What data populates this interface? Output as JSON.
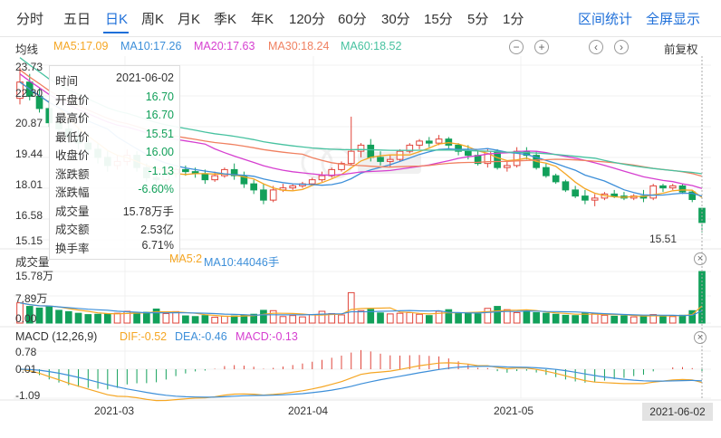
{
  "tabs": [
    {
      "name": "tab-fenshi",
      "label": "分时"
    },
    {
      "name": "tab-5day",
      "label": "五日"
    },
    {
      "name": "tab-daily-k",
      "label": "日K",
      "active": true
    },
    {
      "name": "tab-weekly-k",
      "label": "周K"
    },
    {
      "name": "tab-monthly-k",
      "label": "月K"
    },
    {
      "name": "tab-quarterly-k",
      "label": "季K"
    },
    {
      "name": "tab-yearly-k",
      "label": "年K"
    },
    {
      "name": "tab-120min",
      "label": "120分"
    },
    {
      "name": "tab-60min",
      "label": "60分"
    },
    {
      "name": "tab-30min",
      "label": "30分"
    },
    {
      "name": "tab-15min",
      "label": "15分"
    },
    {
      "name": "tab-5min",
      "label": "5分"
    },
    {
      "name": "tab-1min",
      "label": "1分"
    }
  ],
  "tools": {
    "range_stats": "区间统计",
    "fullscreen": "全屏显示"
  },
  "ma_legend": {
    "title": "均线",
    "ma5": "MA5:17.09",
    "ma10": "MA10:17.26",
    "ma20": "MA20:17.63",
    "ma30": "MA30:18.24",
    "ma60": "MA60:18.52",
    "ma5_color": "#f5a623",
    "ma10_color": "#3d8fd9",
    "ma20_color": "#d63fd0",
    "ma30_color": "#f08060",
    "ma60_color": "#47c2a0"
  },
  "zoom": {
    "out": "−",
    "in": "+",
    "left": "‹",
    "right": "›"
  },
  "adjust_label": "前复权",
  "price_axis": [
    "23.73",
    "22.30",
    "20.87",
    "19.44",
    "18.01",
    "16.58",
    "15.15"
  ],
  "last_price": "15.51",
  "tooltip": [
    {
      "k": "时间",
      "v": "2021-06-02",
      "c": "#333"
    },
    {
      "k": "开盘价",
      "v": "16.70",
      "c": "#12a05a"
    },
    {
      "k": "最高价",
      "v": "16.70",
      "c": "#12a05a"
    },
    {
      "k": "最低价",
      "v": "15.51",
      "c": "#12a05a"
    },
    {
      "k": "收盘价",
      "v": "16.00",
      "c": "#12a05a"
    },
    {
      "k": "涨跌额",
      "v": "-1.13",
      "c": "#12a05a"
    },
    {
      "k": "涨跌幅",
      "v": "-6.60%",
      "c": "#12a05a"
    },
    {
      "k": "成交量",
      "v": "15.78万手",
      "c": "#333"
    },
    {
      "k": "成交额",
      "v": "2.53亿",
      "c": "#333"
    },
    {
      "k": "换手率",
      "v": "6.71%",
      "c": "#333"
    }
  ],
  "volume": {
    "title": "成交量",
    "ma5": "MA5:2",
    "ma10": "MA10:44046手",
    "axis": [
      "15.78万",
      "7.89万",
      "0.00"
    ]
  },
  "macd": {
    "title": "MACD (12,26,9)",
    "dif": "DIF:-0.52",
    "dea": "DEA:-0.46",
    "macd": "MACD:-0.13",
    "axis": [
      "0.78",
      "0.01",
      "-1.09"
    ]
  },
  "x_axis": [
    "2021-03",
    "2021-04",
    "2021-05"
  ],
  "last_date": "2021-06-02",
  "chart_data": {
    "type": "candlestick",
    "up_color": "#e0443a",
    "down_color": "#12a05a",
    "bars": [
      [
        22.1,
        23.6,
        21.8,
        22.9,
        6.2
      ],
      [
        22.9,
        23.3,
        22.0,
        22.2,
        5.1
      ],
      [
        22.2,
        22.6,
        21.4,
        21.6,
        4.6
      ],
      [
        21.6,
        22.0,
        20.7,
        20.9,
        5.0
      ],
      [
        20.9,
        21.3,
        20.2,
        20.6,
        3.9
      ],
      [
        20.6,
        21.0,
        19.9,
        20.2,
        3.5
      ],
      [
        20.2,
        20.6,
        19.6,
        19.9,
        3.0
      ],
      [
        19.9,
        20.4,
        19.3,
        19.6,
        2.6
      ],
      [
        19.6,
        19.9,
        18.9,
        19.2,
        2.7
      ],
      [
        19.2,
        19.5,
        18.5,
        18.8,
        2.8
      ],
      [
        18.8,
        19.3,
        18.6,
        19.0,
        3.0
      ],
      [
        19.0,
        19.6,
        18.8,
        19.3,
        3.6
      ],
      [
        19.3,
        19.5,
        18.5,
        18.7,
        3.1
      ],
      [
        18.7,
        18.9,
        18.0,
        18.2,
        3.3
      ],
      [
        18.2,
        18.5,
        17.9,
        18.1,
        4.3
      ],
      [
        18.1,
        18.6,
        17.9,
        18.4,
        2.9
      ],
      [
        18.4,
        18.7,
        18.2,
        18.6,
        3.5
      ],
      [
        18.6,
        18.8,
        18.3,
        18.5,
        2.2
      ],
      [
        18.5,
        18.7,
        18.2,
        18.4,
        2.0
      ],
      [
        18.4,
        18.6,
        17.9,
        18.1,
        2.3
      ],
      [
        18.1,
        18.5,
        18.0,
        18.3,
        1.8
      ],
      [
        18.3,
        18.7,
        18.2,
        18.6,
        2.1
      ],
      [
        18.6,
        18.9,
        18.1,
        18.3,
        2.2
      ],
      [
        18.3,
        18.5,
        17.7,
        17.9,
        2.5
      ],
      [
        17.9,
        18.1,
        17.4,
        17.6,
        2.7
      ],
      [
        17.6,
        17.9,
        16.9,
        17.1,
        3.9
      ],
      [
        17.1,
        17.8,
        17.0,
        17.6,
        3.8
      ],
      [
        17.6,
        17.9,
        17.5,
        17.7,
        2.0
      ],
      [
        17.7,
        17.9,
        17.6,
        17.8,
        2.3
      ],
      [
        17.8,
        18.0,
        17.7,
        17.9,
        1.9
      ],
      [
        17.9,
        18.2,
        17.8,
        18.1,
        2.5
      ],
      [
        18.1,
        18.5,
        18.0,
        18.3,
        3.6
      ],
      [
        18.3,
        18.7,
        18.2,
        18.6,
        2.9
      ],
      [
        18.6,
        19.0,
        18.5,
        18.9,
        2.5
      ],
      [
        18.9,
        21.2,
        18.8,
        19.5,
        9.3
      ],
      [
        19.5,
        19.9,
        19.2,
        19.8,
        3.8
      ],
      [
        19.8,
        20.1,
        19.0,
        19.2,
        4.2
      ],
      [
        19.2,
        19.5,
        18.8,
        19.0,
        3.1
      ],
      [
        19.0,
        19.3,
        18.7,
        19.1,
        2.8
      ],
      [
        19.1,
        19.6,
        19.0,
        19.5,
        3.0
      ],
      [
        19.5,
        19.9,
        19.4,
        19.8,
        3.2
      ],
      [
        19.8,
        20.1,
        19.6,
        20.0,
        2.7
      ],
      [
        20.0,
        20.2,
        19.7,
        19.9,
        2.3
      ],
      [
        19.9,
        20.3,
        19.8,
        20.1,
        3.6
      ],
      [
        20.1,
        20.2,
        19.6,
        19.8,
        4.1
      ],
      [
        19.8,
        19.9,
        19.3,
        19.5,
        3.1
      ],
      [
        19.5,
        19.8,
        19.1,
        19.3,
        3.0
      ],
      [
        19.3,
        19.5,
        18.8,
        18.9,
        2.8
      ],
      [
        18.9,
        19.6,
        18.7,
        19.5,
        4.5
      ],
      [
        19.5,
        19.6,
        18.6,
        18.7,
        5.1
      ],
      [
        18.7,
        19.0,
        18.5,
        18.8,
        4.1
      ],
      [
        18.8,
        19.7,
        18.7,
        19.5,
        3.2
      ],
      [
        19.5,
        19.7,
        19.1,
        19.3,
        3.5
      ],
      [
        19.3,
        19.5,
        18.6,
        18.7,
        3.2
      ],
      [
        18.7,
        18.9,
        18.2,
        18.3,
        3.0
      ],
      [
        18.3,
        18.4,
        17.9,
        18.0,
        2.7
      ],
      [
        18.0,
        18.1,
        17.5,
        17.6,
        2.4
      ],
      [
        17.6,
        17.8,
        17.2,
        17.3,
        2.3
      ],
      [
        17.3,
        17.6,
        16.9,
        17.1,
        3.2
      ],
      [
        17.1,
        17.4,
        16.8,
        17.2,
        2.9
      ],
      [
        17.2,
        17.5,
        17.1,
        17.4,
        2.4
      ],
      [
        17.4,
        17.6,
        17.2,
        17.3,
        2.1
      ],
      [
        17.3,
        17.5,
        17.1,
        17.2,
        2.2
      ],
      [
        17.2,
        17.4,
        17.1,
        17.3,
        1.9
      ],
      [
        17.3,
        17.6,
        17.0,
        17.2,
        2.3
      ],
      [
        17.2,
        17.9,
        17.1,
        17.8,
        2.6
      ],
      [
        17.8,
        17.9,
        17.5,
        17.7,
        2.2
      ],
      [
        17.7,
        17.9,
        17.6,
        17.8,
        2.0
      ],
      [
        17.8,
        17.9,
        17.4,
        17.5,
        2.4
      ],
      [
        17.5,
        17.6,
        17.0,
        17.13,
        3.8
      ],
      [
        16.7,
        16.7,
        15.51,
        16.0,
        15.78
      ]
    ]
  }
}
